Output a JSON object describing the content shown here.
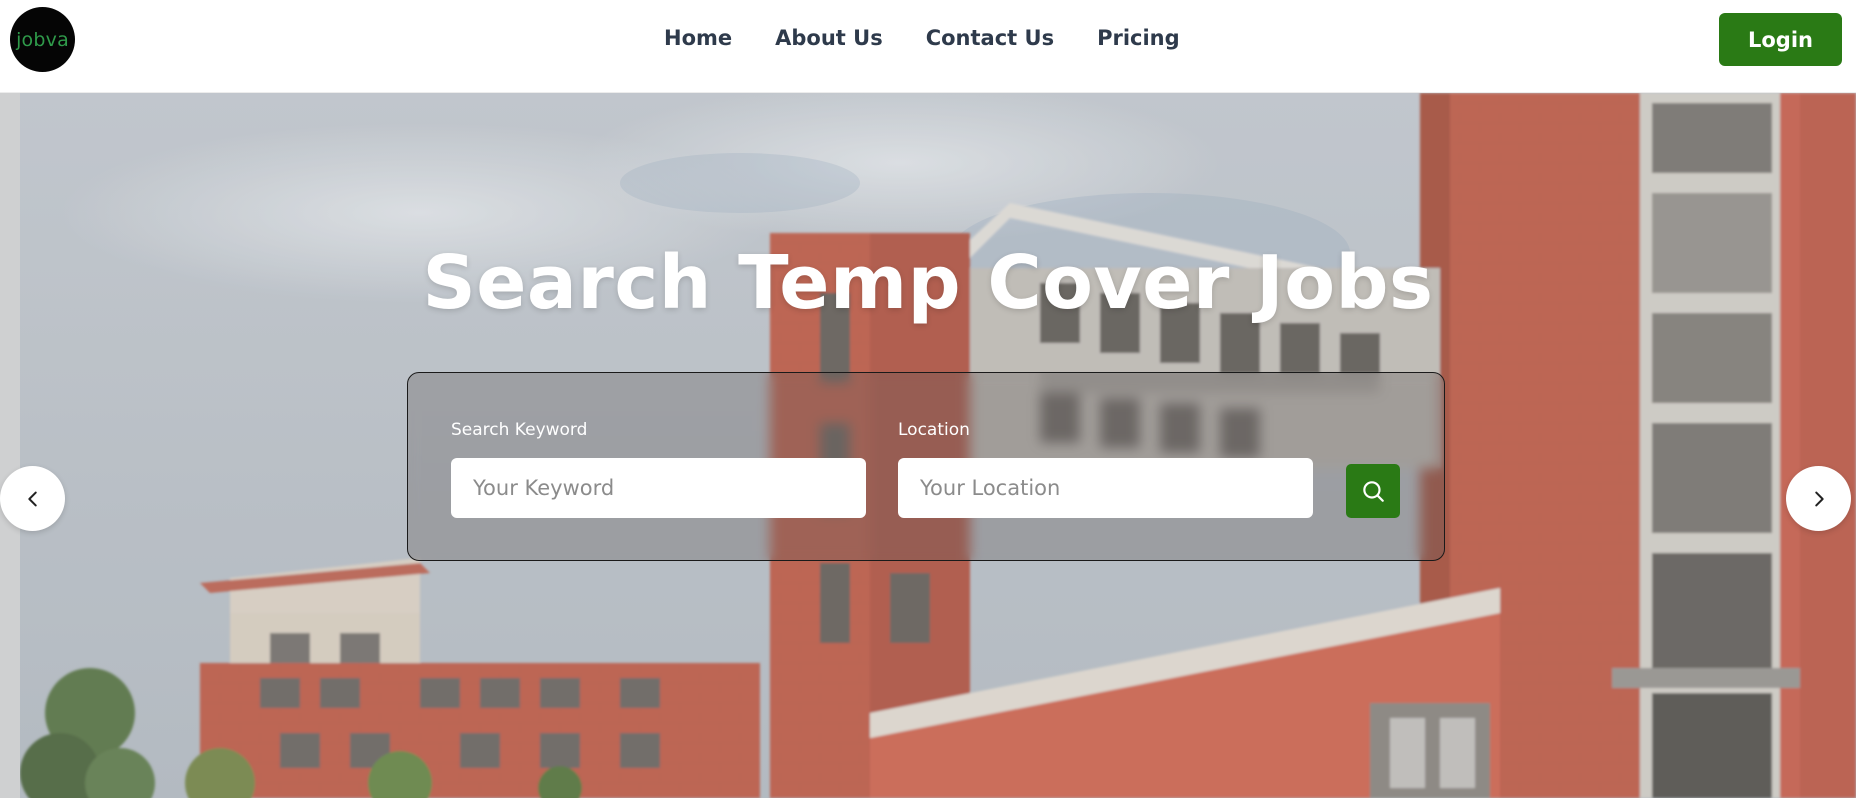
{
  "header": {
    "logo_text": "jobva",
    "nav": [
      {
        "label": "Home"
      },
      {
        "label": "About Us"
      },
      {
        "label": "Contact Us"
      },
      {
        "label": "Pricing"
      }
    ],
    "login_label": "Login"
  },
  "hero": {
    "title": "Search Temp Cover Jobs",
    "keyword_label": "Search Keyword",
    "keyword_placeholder": "Your Keyword",
    "location_label": "Location",
    "location_placeholder": "Your Location",
    "search_icon": "search-icon",
    "prev_icon": "chevron-left-icon",
    "next_icon": "chevron-right-icon"
  },
  "colors": {
    "brand_green": "#2a7a15",
    "logo_bg": "#050505",
    "logo_text": "#2f9a4a",
    "nav_text": "#2e3a4b"
  }
}
